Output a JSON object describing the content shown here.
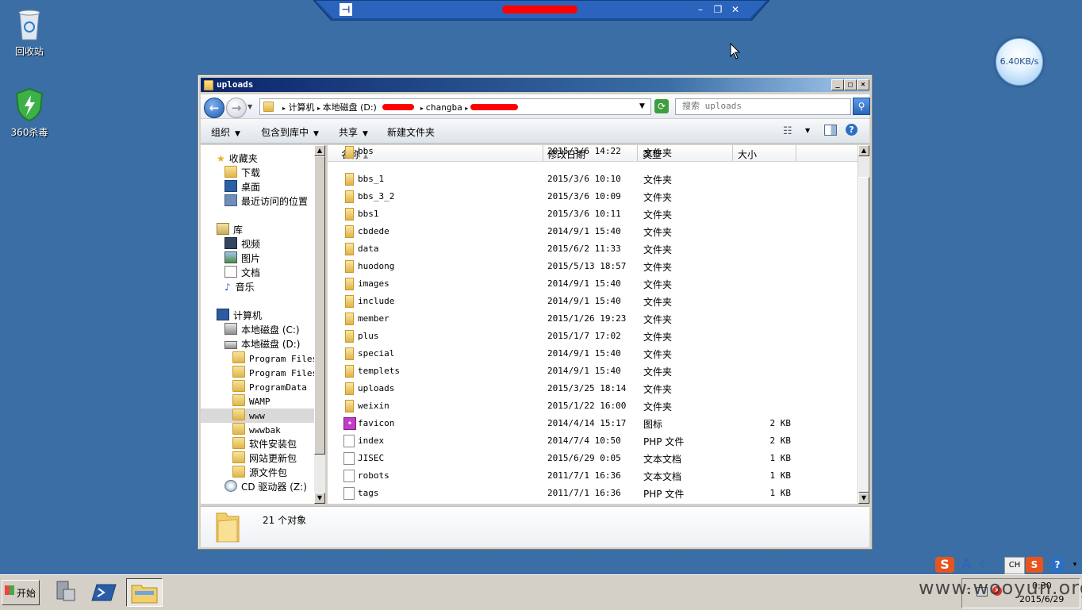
{
  "desktop": {
    "recycle_bin_label": "回收站",
    "antivirus_label": "360杀毒"
  },
  "speed_widget": {
    "value": "6.40KB/s"
  },
  "rdp": {
    "pin_icon": "pin-icon"
  },
  "window": {
    "title": "uploads",
    "address": {
      "parts": [
        "计算机",
        "本地磁盘 (D:)",
        "changba"
      ]
    },
    "search_placeholder": "搜索 uploads",
    "commands": {
      "organize": "组织",
      "include_in_library": "包含到库中",
      "share": "共享",
      "new_folder": "新建文件夹"
    },
    "nav": {
      "favorites": "收藏夹",
      "downloads": "下载",
      "desktop": "桌面",
      "recent": "最近访问的位置",
      "libraries": "库",
      "videos": "视频",
      "pictures": "图片",
      "documents": "文档",
      "music": "音乐",
      "computer": "计算机",
      "drive_c": "本地磁盘 (C:)",
      "drive_d": "本地磁盘 (D:)",
      "folders": [
        "Program Files",
        "Program Files",
        "ProgramData",
        "WAMP",
        "www",
        "wwwbak",
        "软件安装包",
        "网站更新包",
        "源文件包"
      ],
      "cd_drive": "CD 驱动器 (Z:)"
    },
    "columns": {
      "name": "名称",
      "modified": "修改日期",
      "type": "类型",
      "size": "大小"
    },
    "files": [
      {
        "name": "bbs",
        "date": "2015/3/6 14:22",
        "type": "文件夹",
        "size": "",
        "kind": "folder"
      },
      {
        "name": "bbs_1",
        "date": "2015/3/6 10:10",
        "type": "文件夹",
        "size": "",
        "kind": "folder"
      },
      {
        "name": "bbs_3_2",
        "date": "2015/3/6 10:09",
        "type": "文件夹",
        "size": "",
        "kind": "folder"
      },
      {
        "name": "bbs1",
        "date": "2015/3/6 10:11",
        "type": "文件夹",
        "size": "",
        "kind": "folder"
      },
      {
        "name": "cbdede",
        "date": "2014/9/1 15:40",
        "type": "文件夹",
        "size": "",
        "kind": "folder"
      },
      {
        "name": "data",
        "date": "2015/6/2 11:33",
        "type": "文件夹",
        "size": "",
        "kind": "folder"
      },
      {
        "name": "huodong",
        "date": "2015/5/13 18:57",
        "type": "文件夹",
        "size": "",
        "kind": "folder"
      },
      {
        "name": "images",
        "date": "2014/9/1 15:40",
        "type": "文件夹",
        "size": "",
        "kind": "folder"
      },
      {
        "name": "include",
        "date": "2014/9/1 15:40",
        "type": "文件夹",
        "size": "",
        "kind": "folder"
      },
      {
        "name": "member",
        "date": "2015/1/26 19:23",
        "type": "文件夹",
        "size": "",
        "kind": "folder"
      },
      {
        "name": "plus",
        "date": "2015/1/7 17:02",
        "type": "文件夹",
        "size": "",
        "kind": "folder"
      },
      {
        "name": "special",
        "date": "2014/9/1 15:40",
        "type": "文件夹",
        "size": "",
        "kind": "folder"
      },
      {
        "name": "templets",
        "date": "2014/9/1 15:40",
        "type": "文件夹",
        "size": "",
        "kind": "folder"
      },
      {
        "name": "uploads",
        "date": "2015/3/25 18:14",
        "type": "文件夹",
        "size": "",
        "kind": "folder"
      },
      {
        "name": "weixin",
        "date": "2015/1/22 16:00",
        "type": "文件夹",
        "size": "",
        "kind": "folder"
      },
      {
        "name": "favicon",
        "date": "2014/4/14 15:17",
        "type": "图标",
        "size": "2 KB",
        "kind": "icon"
      },
      {
        "name": "index",
        "date": "2014/7/4 10:50",
        "type": "PHP 文件",
        "size": "2 KB",
        "kind": "doc"
      },
      {
        "name": "JISEC",
        "date": "2015/6/29 0:05",
        "type": "文本文档",
        "size": "1 KB",
        "kind": "doc"
      },
      {
        "name": "robots",
        "date": "2011/7/1 16:36",
        "type": "文本文档",
        "size": "1 KB",
        "kind": "doc"
      },
      {
        "name": "tags",
        "date": "2011/7/1 16:36",
        "type": "PHP 文件",
        "size": "1 KB",
        "kind": "doc"
      }
    ],
    "status_text": "21 个对象"
  },
  "taskbar": {
    "start_label": "开始",
    "clock_time": "0:30",
    "clock_date": "2015/6/29",
    "ime": [
      "A",
      "CH"
    ]
  },
  "watermark": "www.wooyun.org"
}
